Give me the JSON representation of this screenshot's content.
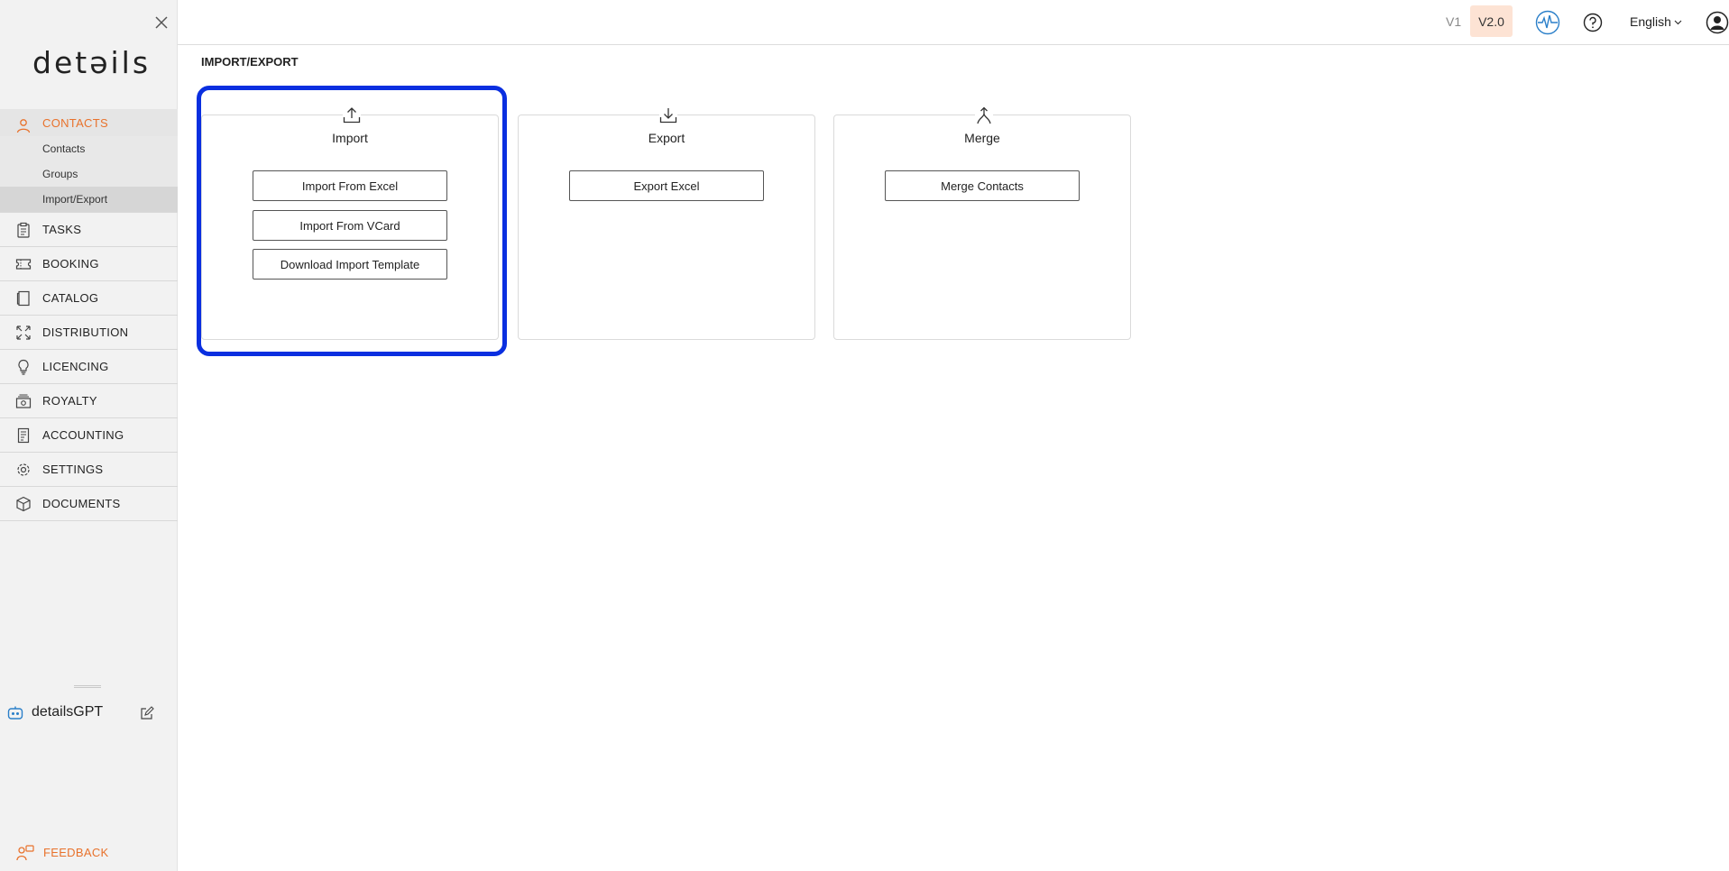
{
  "sidebar": {
    "logo": "detəils",
    "sections": [
      {
        "label": "CONTACTS",
        "icon": "person-icon",
        "active": true
      },
      {
        "label": "TASKS",
        "icon": "clipboard-icon"
      },
      {
        "label": "BOOKING",
        "icon": "ticket-icon"
      },
      {
        "label": "CATALOG",
        "icon": "book-icon"
      },
      {
        "label": "DISTRIBUTION",
        "icon": "expand-arrows-icon"
      },
      {
        "label": "LICENCING",
        "icon": "lightbulb-icon"
      },
      {
        "label": "ROYALTY",
        "icon": "money-icon"
      },
      {
        "label": "ACCOUNTING",
        "icon": "receipt-icon"
      },
      {
        "label": "SETTINGS",
        "icon": "gear-icon"
      },
      {
        "label": "DOCUMENTS",
        "icon": "cube-icon"
      }
    ],
    "contacts_subitems": [
      "Contacts",
      "Groups",
      "Import/Export"
    ],
    "gpt_label": "detailsGPT",
    "feedback_label": "FEEDBACK"
  },
  "header": {
    "v1_label": "V1",
    "v2_label": "V2.0",
    "language": "English"
  },
  "main": {
    "title": "IMPORT/EXPORT",
    "cards": [
      {
        "title": "Import",
        "buttons": [
          "Import From Excel",
          "Import From VCard",
          "Download Import Template"
        ]
      },
      {
        "title": "Export",
        "buttons": [
          "Export Excel"
        ]
      },
      {
        "title": "Merge",
        "buttons": [
          "Merge Contacts"
        ]
      }
    ]
  },
  "colors": {
    "accent": "#e8722c",
    "highlight": "#0a2fe0",
    "version_badge": "#fde3d4"
  }
}
